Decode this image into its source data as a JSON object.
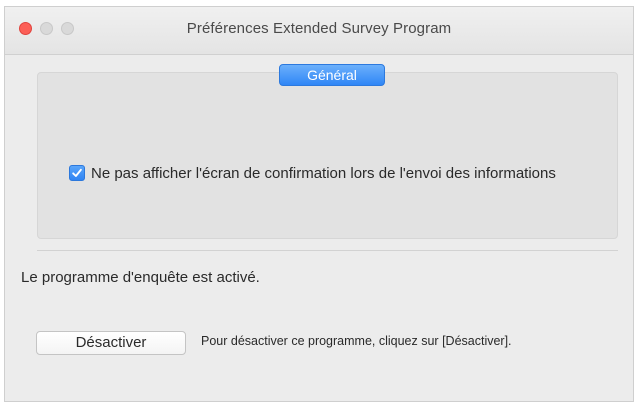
{
  "window": {
    "title": "Préférences Extended Survey Program"
  },
  "tabs": {
    "general_label": "Général"
  },
  "settings": {
    "hide_confirmation": {
      "checked": true,
      "label": "Ne pas afficher l'écran de confirmation lors de l'envoi des informations"
    }
  },
  "status": {
    "text": "Le programme d'enquête est activé."
  },
  "actions": {
    "deactivate_label": "Désactiver",
    "deactivate_hint": "Pour désactiver ce programme, cliquez sur [Désactiver]."
  },
  "colors": {
    "accent": "#2f86f6",
    "close_button": "#fc5f57",
    "window_background": "#ececec"
  },
  "icons": {
    "close": "close-icon",
    "minimize": "minimize-icon",
    "zoom": "zoom-icon",
    "checkmark": "checkmark-icon"
  }
}
